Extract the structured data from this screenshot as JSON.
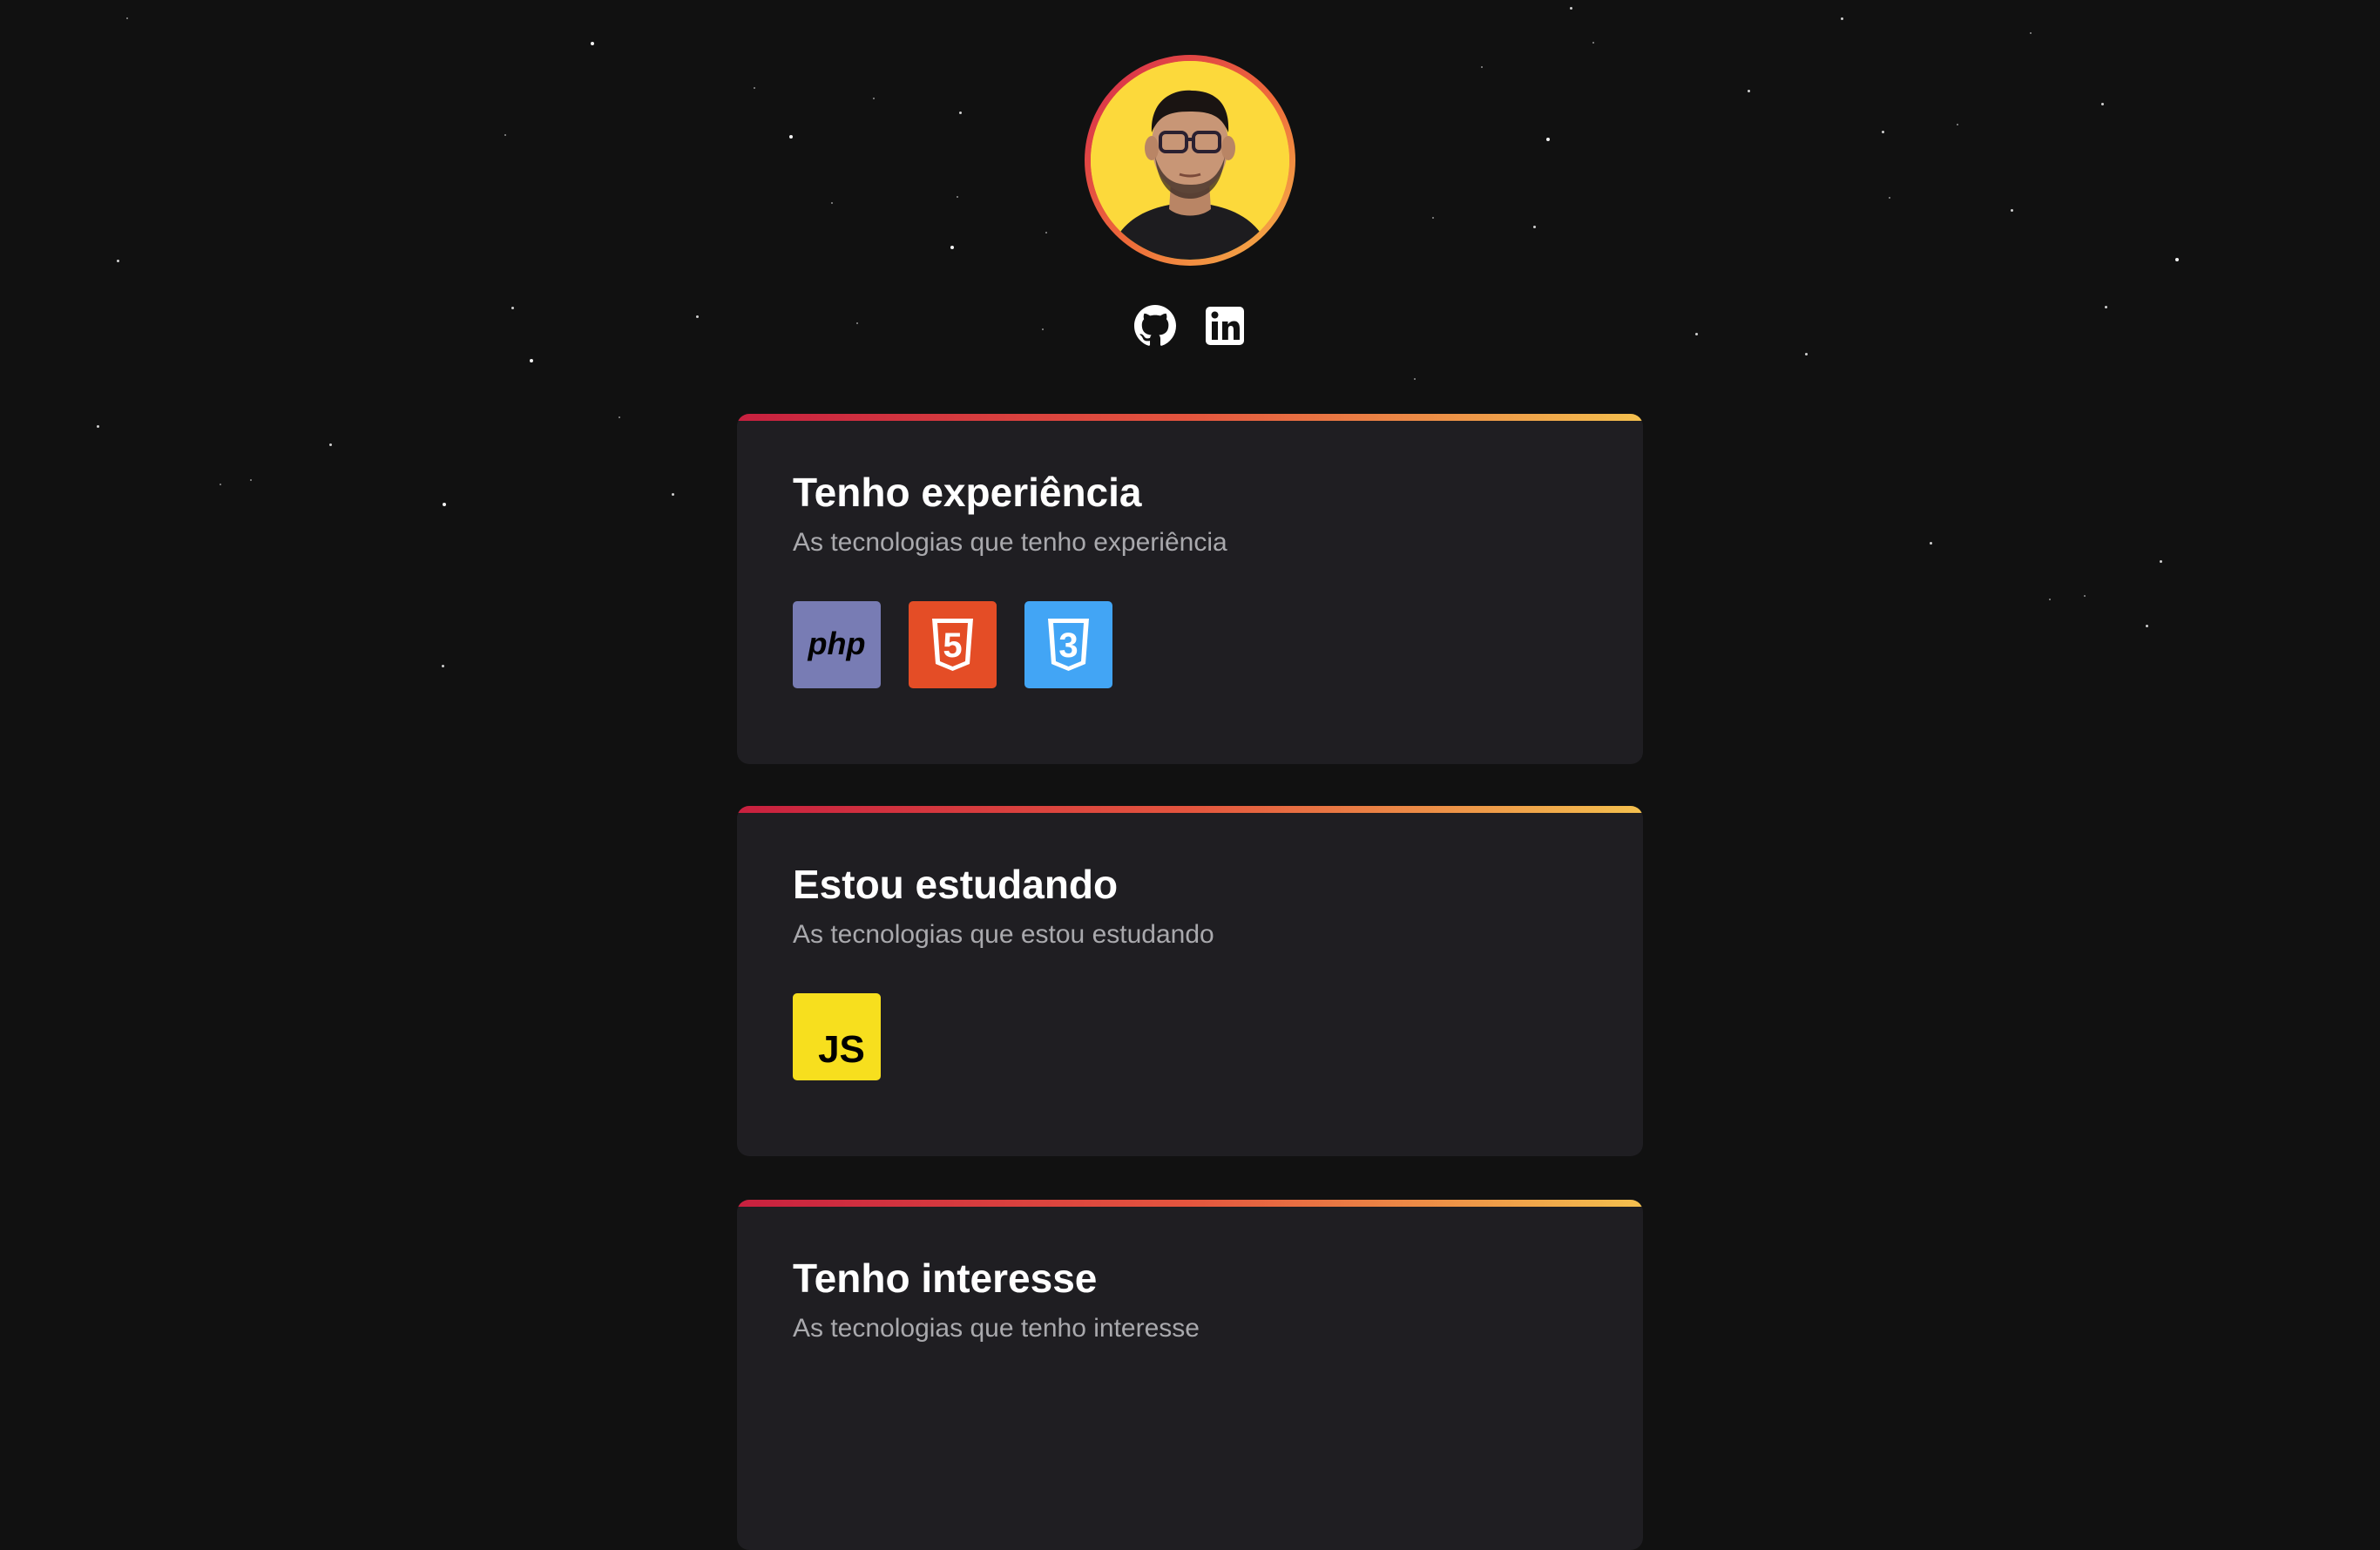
{
  "profile": {
    "avatar_alt": "profile-photo"
  },
  "social": [
    {
      "name": "GitHub",
      "icon": "github-icon"
    },
    {
      "name": "LinkedIn",
      "icon": "linkedin-icon"
    }
  ],
  "sections": [
    {
      "title": "Tenho experiência",
      "subtitle": "As tecnologias que tenho experiência",
      "techs": [
        {
          "name": "PHP",
          "label": "php",
          "icon": "php-icon",
          "color": "#787cb4"
        },
        {
          "name": "HTML5",
          "label": "5",
          "icon": "html5-icon",
          "color": "#e44d26"
        },
        {
          "name": "CSS3",
          "label": "3",
          "icon": "css3-icon",
          "color": "#42a5f5"
        }
      ]
    },
    {
      "title": "Estou estudando",
      "subtitle": "As tecnologias que estou estudando",
      "techs": [
        {
          "name": "JavaScript",
          "label": "JS",
          "icon": "js-icon",
          "color": "#f7df1e"
        }
      ]
    },
    {
      "title": "Tenho interesse",
      "subtitle": "As tecnologias que tenho interesse",
      "techs": []
    }
  ],
  "colors": {
    "background": "#111111",
    "card": "#1f1e22",
    "accent_gradient": [
      "#c8203f",
      "#e4553e",
      "#f4c04e"
    ],
    "title": "#ffffff",
    "subtitle": "#a9a9ad"
  }
}
